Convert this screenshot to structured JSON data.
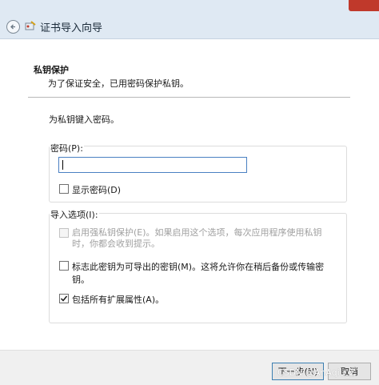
{
  "window": {
    "title": "证书导入向导"
  },
  "section": {
    "heading": "私钥保护",
    "description": "为了保证安全，已用密码保护私钥。"
  },
  "prompt": "为私钥键入密码。",
  "password_group": {
    "label": "密码(P):",
    "input_value": "",
    "show_password_label": "显示密码(D)",
    "show_password_checked": false
  },
  "import_options": {
    "label": "导入选项(I):",
    "options": [
      {
        "label": "启用强私钥保护(E)。如果启用这个选项，每次应用程序使用私钥时，你都会收到提示。",
        "checked": false,
        "disabled": true
      },
      {
        "label": "标志此密钥为可导出的密钥(M)。这将允许你在稍后备份或传输密钥。",
        "checked": false,
        "disabled": false
      },
      {
        "label": "包括所有扩展属性(A)。",
        "checked": true,
        "disabled": false
      }
    ]
  },
  "footer": {
    "next_label": "下一步(N)",
    "cancel_label": "取消"
  },
  "watermark": "CSDN @AnAqiu_Z",
  "icons": {
    "back": "back-arrow-icon",
    "wizard": "certificate-wizard-icon",
    "check": "checkmark-icon"
  }
}
